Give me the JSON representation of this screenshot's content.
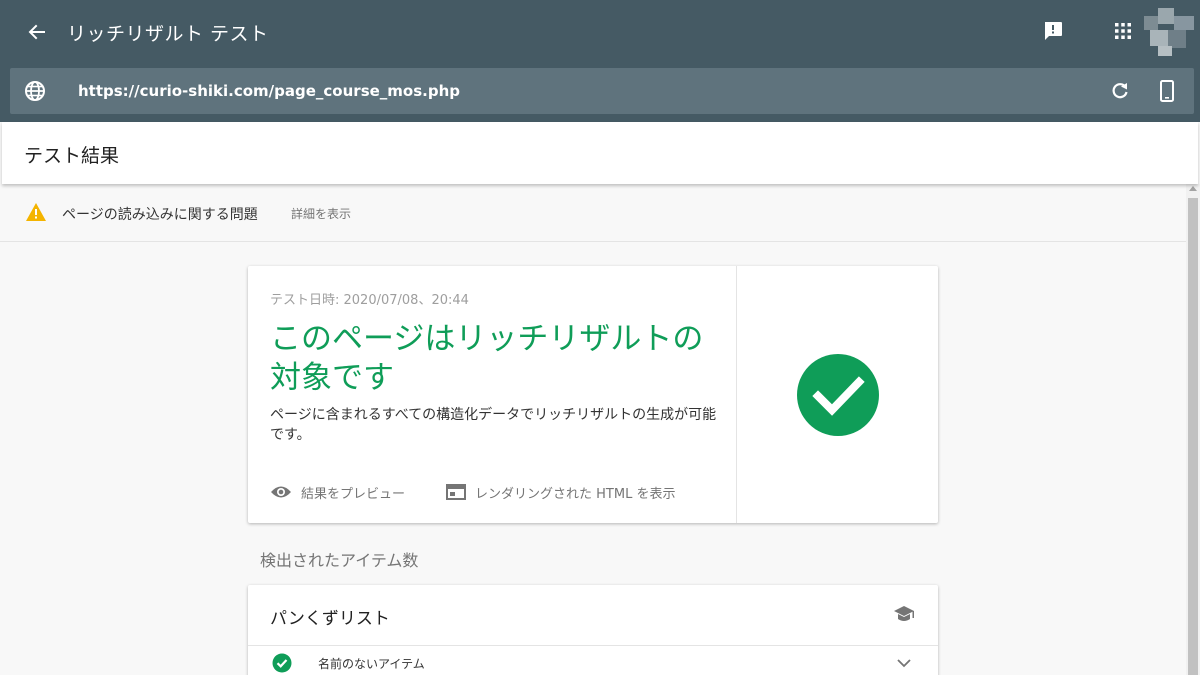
{
  "topbar": {
    "title": "リッチリザルト テスト",
    "url": "https://curio-shiki.com/page_course_mos.php",
    "icons": {
      "back": "arrow-back-icon",
      "feedback": "feedback-icon",
      "apps": "apps-grid-icon",
      "globe": "globe-icon",
      "reload": "reload-icon",
      "device": "smartphone-icon"
    },
    "color": "#455a64"
  },
  "results_header": {
    "title": "テスト結果"
  },
  "warning": {
    "text": "ページの読み込みに関する問題",
    "link": "詳細を表示",
    "icon": "warning-icon",
    "color": "#f4b400"
  },
  "status_card": {
    "date": "テスト日時: 2020/07/08、20:44",
    "headline": "このページはリッチリザルトの対象です",
    "description": "ページに含まれるすべての構造化データでリッチリザルトの生成が可能です。",
    "actions": [
      {
        "label": "結果をプレビュー",
        "icon": "eye-icon"
      },
      {
        "label": "レンダリングされた HTML を表示",
        "icon": "web-page-icon"
      }
    ],
    "status_icon": "check-circle-icon",
    "accent": "#0f9d58"
  },
  "detected": {
    "label": "検出されたアイテム数"
  },
  "items_card": {
    "title": "パンくずリスト",
    "icon": "school-icon",
    "rows": [
      {
        "label": "名前のないアイテム",
        "icon": "check-circle-icon"
      }
    ]
  }
}
